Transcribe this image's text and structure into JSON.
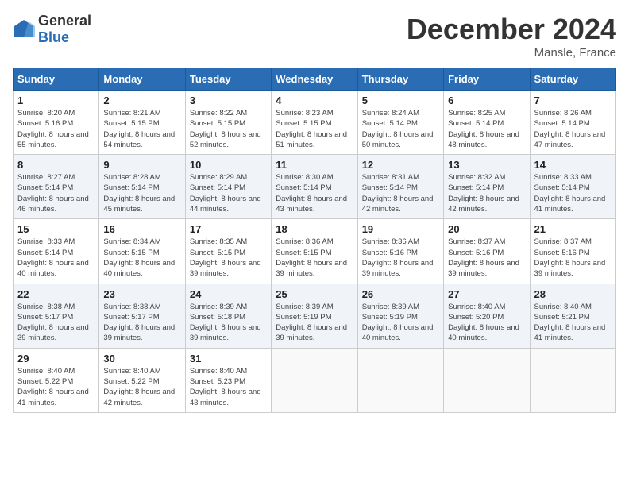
{
  "logo": {
    "text_general": "General",
    "text_blue": "Blue"
  },
  "title": "December 2024",
  "location": "Mansle, France",
  "days_of_week": [
    "Sunday",
    "Monday",
    "Tuesday",
    "Wednesday",
    "Thursday",
    "Friday",
    "Saturday"
  ],
  "weeks": [
    [
      {
        "day": "1",
        "sunrise": "Sunrise: 8:20 AM",
        "sunset": "Sunset: 5:16 PM",
        "daylight": "Daylight: 8 hours and 55 minutes."
      },
      {
        "day": "2",
        "sunrise": "Sunrise: 8:21 AM",
        "sunset": "Sunset: 5:15 PM",
        "daylight": "Daylight: 8 hours and 54 minutes."
      },
      {
        "day": "3",
        "sunrise": "Sunrise: 8:22 AM",
        "sunset": "Sunset: 5:15 PM",
        "daylight": "Daylight: 8 hours and 52 minutes."
      },
      {
        "day": "4",
        "sunrise": "Sunrise: 8:23 AM",
        "sunset": "Sunset: 5:15 PM",
        "daylight": "Daylight: 8 hours and 51 minutes."
      },
      {
        "day": "5",
        "sunrise": "Sunrise: 8:24 AM",
        "sunset": "Sunset: 5:14 PM",
        "daylight": "Daylight: 8 hours and 50 minutes."
      },
      {
        "day": "6",
        "sunrise": "Sunrise: 8:25 AM",
        "sunset": "Sunset: 5:14 PM",
        "daylight": "Daylight: 8 hours and 48 minutes."
      },
      {
        "day": "7",
        "sunrise": "Sunrise: 8:26 AM",
        "sunset": "Sunset: 5:14 PM",
        "daylight": "Daylight: 8 hours and 47 minutes."
      }
    ],
    [
      {
        "day": "8",
        "sunrise": "Sunrise: 8:27 AM",
        "sunset": "Sunset: 5:14 PM",
        "daylight": "Daylight: 8 hours and 46 minutes."
      },
      {
        "day": "9",
        "sunrise": "Sunrise: 8:28 AM",
        "sunset": "Sunset: 5:14 PM",
        "daylight": "Daylight: 8 hours and 45 minutes."
      },
      {
        "day": "10",
        "sunrise": "Sunrise: 8:29 AM",
        "sunset": "Sunset: 5:14 PM",
        "daylight": "Daylight: 8 hours and 44 minutes."
      },
      {
        "day": "11",
        "sunrise": "Sunrise: 8:30 AM",
        "sunset": "Sunset: 5:14 PM",
        "daylight": "Daylight: 8 hours and 43 minutes."
      },
      {
        "day": "12",
        "sunrise": "Sunrise: 8:31 AM",
        "sunset": "Sunset: 5:14 PM",
        "daylight": "Daylight: 8 hours and 42 minutes."
      },
      {
        "day": "13",
        "sunrise": "Sunrise: 8:32 AM",
        "sunset": "Sunset: 5:14 PM",
        "daylight": "Daylight: 8 hours and 42 minutes."
      },
      {
        "day": "14",
        "sunrise": "Sunrise: 8:33 AM",
        "sunset": "Sunset: 5:14 PM",
        "daylight": "Daylight: 8 hours and 41 minutes."
      }
    ],
    [
      {
        "day": "15",
        "sunrise": "Sunrise: 8:33 AM",
        "sunset": "Sunset: 5:14 PM",
        "daylight": "Daylight: 8 hours and 40 minutes."
      },
      {
        "day": "16",
        "sunrise": "Sunrise: 8:34 AM",
        "sunset": "Sunset: 5:15 PM",
        "daylight": "Daylight: 8 hours and 40 minutes."
      },
      {
        "day": "17",
        "sunrise": "Sunrise: 8:35 AM",
        "sunset": "Sunset: 5:15 PM",
        "daylight": "Daylight: 8 hours and 39 minutes."
      },
      {
        "day": "18",
        "sunrise": "Sunrise: 8:36 AM",
        "sunset": "Sunset: 5:15 PM",
        "daylight": "Daylight: 8 hours and 39 minutes."
      },
      {
        "day": "19",
        "sunrise": "Sunrise: 8:36 AM",
        "sunset": "Sunset: 5:16 PM",
        "daylight": "Daylight: 8 hours and 39 minutes."
      },
      {
        "day": "20",
        "sunrise": "Sunrise: 8:37 AM",
        "sunset": "Sunset: 5:16 PM",
        "daylight": "Daylight: 8 hours and 39 minutes."
      },
      {
        "day": "21",
        "sunrise": "Sunrise: 8:37 AM",
        "sunset": "Sunset: 5:16 PM",
        "daylight": "Daylight: 8 hours and 39 minutes."
      }
    ],
    [
      {
        "day": "22",
        "sunrise": "Sunrise: 8:38 AM",
        "sunset": "Sunset: 5:17 PM",
        "daylight": "Daylight: 8 hours and 39 minutes."
      },
      {
        "day": "23",
        "sunrise": "Sunrise: 8:38 AM",
        "sunset": "Sunset: 5:17 PM",
        "daylight": "Daylight: 8 hours and 39 minutes."
      },
      {
        "day": "24",
        "sunrise": "Sunrise: 8:39 AM",
        "sunset": "Sunset: 5:18 PM",
        "daylight": "Daylight: 8 hours and 39 minutes."
      },
      {
        "day": "25",
        "sunrise": "Sunrise: 8:39 AM",
        "sunset": "Sunset: 5:19 PM",
        "daylight": "Daylight: 8 hours and 39 minutes."
      },
      {
        "day": "26",
        "sunrise": "Sunrise: 8:39 AM",
        "sunset": "Sunset: 5:19 PM",
        "daylight": "Daylight: 8 hours and 40 minutes."
      },
      {
        "day": "27",
        "sunrise": "Sunrise: 8:40 AM",
        "sunset": "Sunset: 5:20 PM",
        "daylight": "Daylight: 8 hours and 40 minutes."
      },
      {
        "day": "28",
        "sunrise": "Sunrise: 8:40 AM",
        "sunset": "Sunset: 5:21 PM",
        "daylight": "Daylight: 8 hours and 41 minutes."
      }
    ],
    [
      {
        "day": "29",
        "sunrise": "Sunrise: 8:40 AM",
        "sunset": "Sunset: 5:22 PM",
        "daylight": "Daylight: 8 hours and 41 minutes."
      },
      {
        "day": "30",
        "sunrise": "Sunrise: 8:40 AM",
        "sunset": "Sunset: 5:22 PM",
        "daylight": "Daylight: 8 hours and 42 minutes."
      },
      {
        "day": "31",
        "sunrise": "Sunrise: 8:40 AM",
        "sunset": "Sunset: 5:23 PM",
        "daylight": "Daylight: 8 hours and 43 minutes."
      },
      null,
      null,
      null,
      null
    ]
  ]
}
